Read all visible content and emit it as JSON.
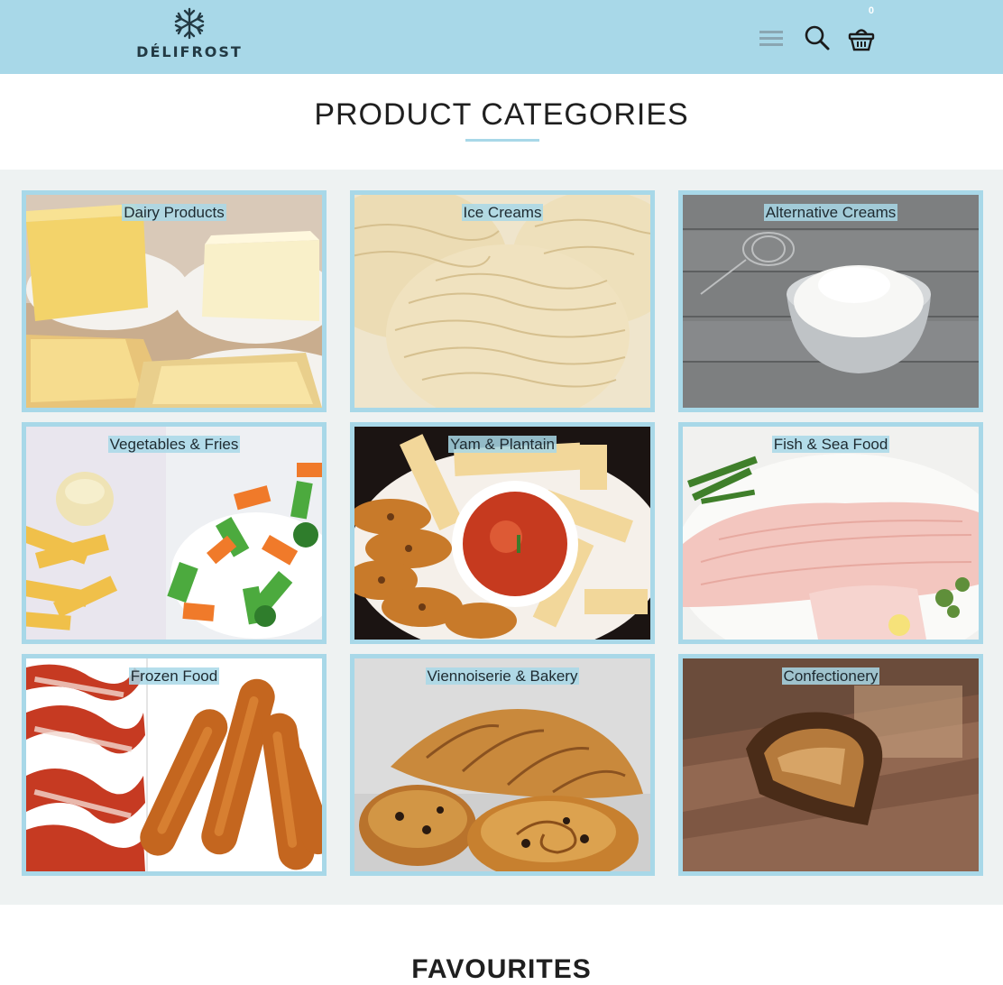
{
  "header": {
    "brand": "DÉLIFROST",
    "cart_count": "0",
    "accent": "#a8d8e8"
  },
  "icons": {
    "logo": "snowflake-icon",
    "menu": "menu-icon",
    "search": "search-icon",
    "cart": "basket-icon"
  },
  "main": {
    "title": "PRODUCT CATEGORIES",
    "categories": [
      {
        "label": "Dairy Products"
      },
      {
        "label": "Ice Creams"
      },
      {
        "label": "Alternative Creams"
      },
      {
        "label": "Vegetables & Fries"
      },
      {
        "label": "Yam & Plantain"
      },
      {
        "label": "Fish & Sea Food"
      },
      {
        "label": "Frozen Food"
      },
      {
        "label": "Viennoiserie & Bakery"
      },
      {
        "label": "Confectionery"
      }
    ]
  },
  "favourites": {
    "title": "FAVOURITES"
  }
}
